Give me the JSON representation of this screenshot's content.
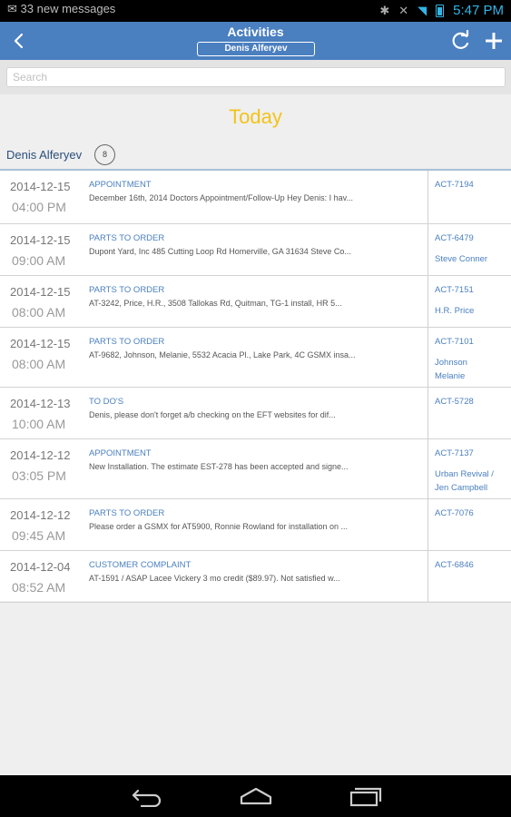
{
  "status_bar": {
    "notification_text": "33 new messages",
    "time": "5:47 PM"
  },
  "header": {
    "title": "Activities",
    "user_selector": "Denis Alferyev"
  },
  "search": {
    "placeholder": "Search",
    "value": ""
  },
  "section": {
    "title": "Today"
  },
  "group": {
    "name": "Denis Alferyev",
    "count": "8"
  },
  "activities": [
    {
      "date": "2014-12-15",
      "time": "04:00 PM",
      "type": "APPOINTMENT",
      "description": "December 16th, 2014 Doctors Appointment/Follow-Up Hey Denis: I hav...",
      "id": "ACT-7194",
      "contact": ""
    },
    {
      "date": "2014-12-15",
      "time": "09:00 AM",
      "type": "PARTS TO ORDER",
      "description": "Dupont Yard, Inc 485 Cutting Loop Rd Homerville, GA 31634 Steve Co...",
      "id": "ACT-6479",
      "contact": "Steve Conner"
    },
    {
      "date": "2014-12-15",
      "time": "08:00 AM",
      "type": "PARTS TO ORDER",
      "description": "AT-3242, Price, H.R., 3508 Tallokas Rd, Quitman, TG-1 install, HR 5...",
      "id": "ACT-7151",
      "contact": "H.R. Price"
    },
    {
      "date": "2014-12-15",
      "time": "08:00 AM",
      "type": "PARTS TO ORDER",
      "description": "AT-9682, Johnson, Melanie, 5532 Acacia Pl., Lake Park, 4C GSMX insa...",
      "id": "ACT-7101",
      "contact": "Johnson Melanie"
    },
    {
      "date": "2014-12-13",
      "time": "10:00 AM",
      "type": "TO DO'S",
      "description": "Denis, please don't forget a/b checking on the EFT websites for dif...",
      "id": "ACT-5728",
      "contact": ""
    },
    {
      "date": "2014-12-12",
      "time": "03:05 PM",
      "type": "APPOINTMENT",
      "description": "New Installation. The estimate EST-278 has been accepted and signe...",
      "id": "ACT-7137",
      "contact": "Urban Revival / Jen Campbell"
    },
    {
      "date": "2014-12-12",
      "time": "09:45 AM",
      "type": "PARTS TO ORDER",
      "description": "Please order a GSMX for AT5900, Ronnie Rowland for installation on ...",
      "id": "ACT-7076",
      "contact": ""
    },
    {
      "date": "2014-12-04",
      "time": "08:52 AM",
      "type": "CUSTOMER COMPLAINT",
      "description": "AT-1591 / ASAP Lacee Vickery 3 mo credit ($89.97). Not satisfied w...",
      "id": "ACT-6846",
      "contact": ""
    }
  ],
  "icons": {
    "back": "back-arrow-icon",
    "refresh": "refresh-icon",
    "add": "plus-icon",
    "nav_back": "back-icon",
    "nav_home": "home-icon",
    "nav_recent": "recent-apps-icon"
  },
  "colors": {
    "header_bg": "#4a7fc0",
    "section_title": "#f3c318",
    "link": "#4a7fc0",
    "status_accent": "#33b5e5"
  }
}
